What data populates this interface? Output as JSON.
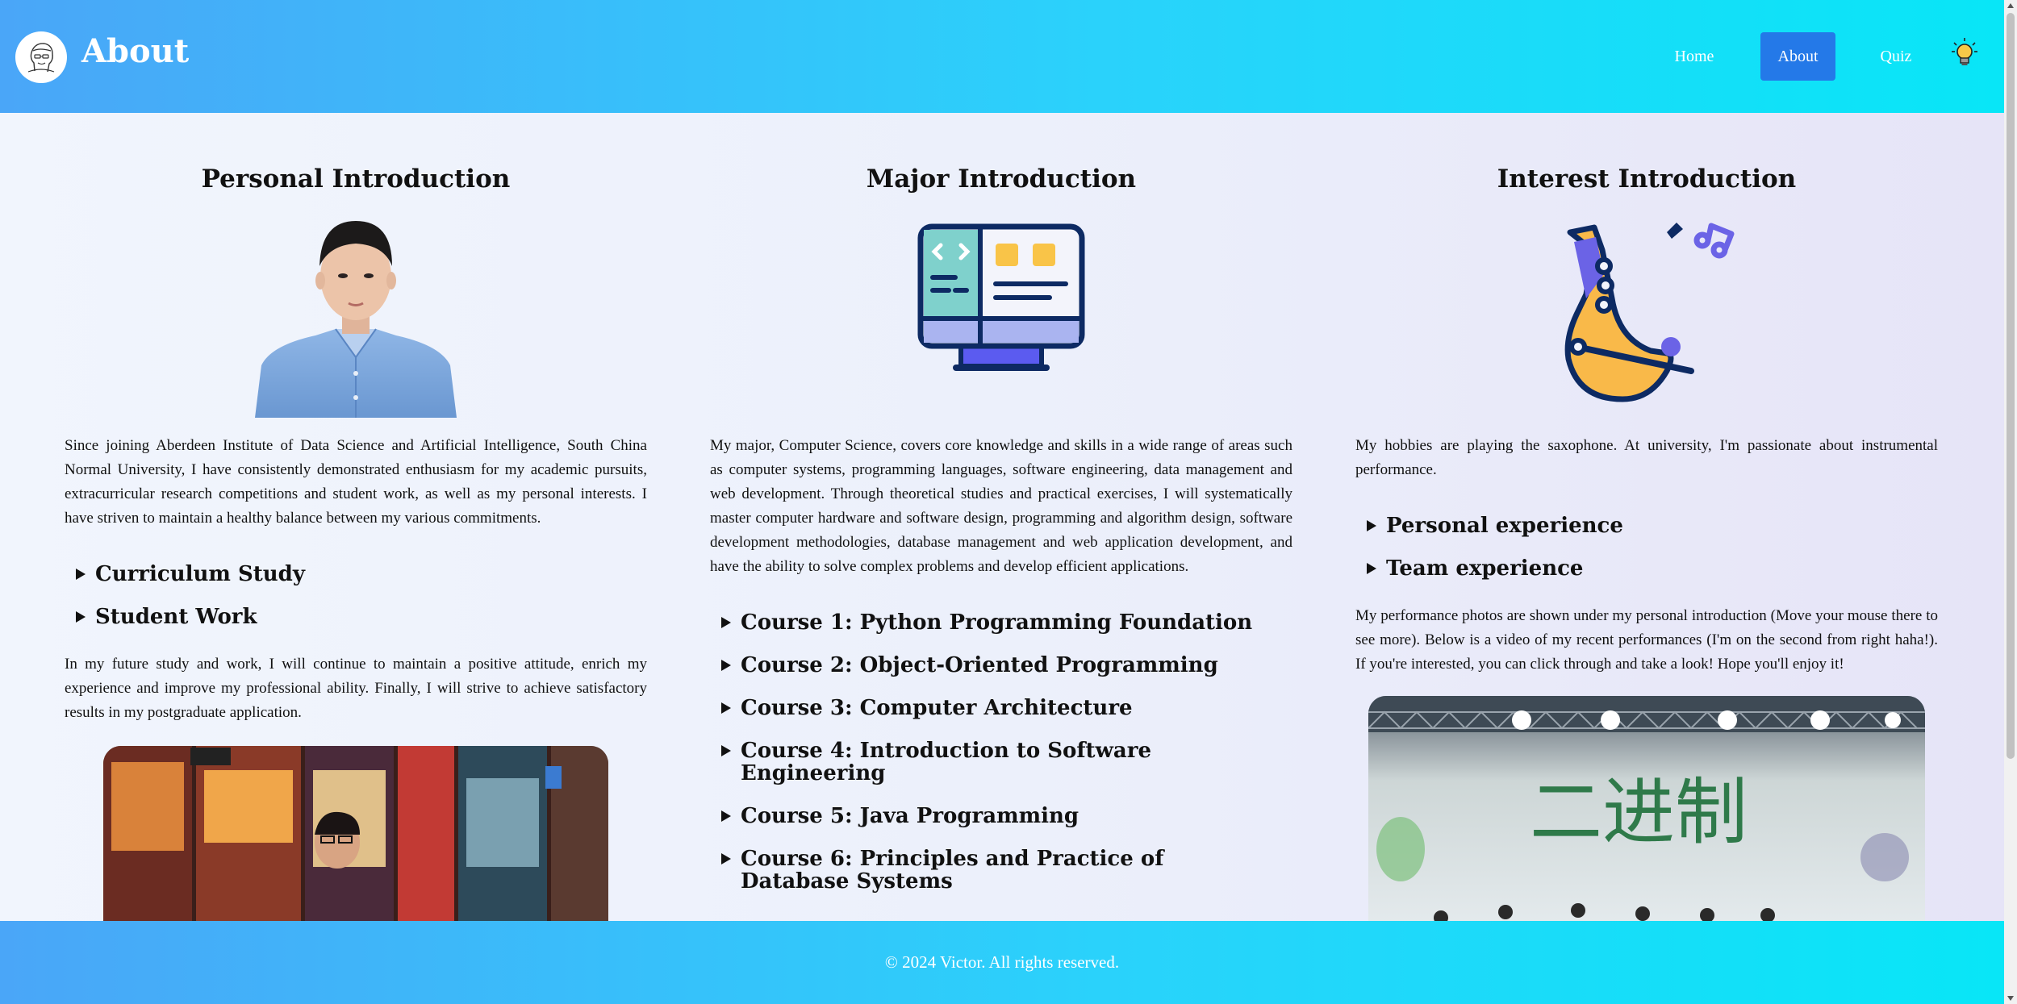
{
  "header": {
    "title": "About",
    "nav": {
      "home": "Home",
      "about": "About",
      "quiz": "Quiz"
    },
    "accent_color": "#2479e8"
  },
  "columns": {
    "personal": {
      "title": "Personal Introduction",
      "intro": "Since joining Aberdeen Institute of Data Science and Artificial Intelligence, South China Normal University, I have consistently demonstrated enthusiasm for my academic pursuits, extracurricular research competitions and student work, as well as my personal interests. I have striven to maintain a healthy balance between my various commitments.",
      "details": [
        "Curriculum Study",
        "Student Work"
      ],
      "outro": "In my future study and work, I will continue to maintain a positive attitude, enrich my experience and improve my professional ability. Finally, I will strive to achieve satisfactory results in my postgraduate application."
    },
    "major": {
      "title": "Major Introduction",
      "intro": "My major, Computer Science, covers core knowledge and skills in a wide range of areas such as computer systems, programming languages, software engineering, data management and web development. Through theoretical studies and practical exercises, I will systematically master computer hardware and software design, programming and algorithm design, software development methodologies, database management and web application development, and have the ability to solve complex problems and develop efficient applications.",
      "courses": [
        "Course 1: Python Programming Foundation",
        "Course 2: Object-Oriented Programming",
        "Course 3: Computer Architecture",
        "Course 4: Introduction to Software Engineering",
        "Course 5: Java Programming",
        "Course 6: Principles and Practice of Database Systems"
      ]
    },
    "interest": {
      "title": "Interest Introduction",
      "intro": "My hobbies are playing the saxophone. At university, I'm passionate about instrumental performance.",
      "details": [
        "Personal experience",
        "Team experience"
      ],
      "outro": "My performance photos are shown under my personal introduction (Move your mouse there to see more). Below is a video of my recent performances (I'm on the second from right haha!). If you're interested, you can click through and take a look! Hope you'll enjoy it!",
      "banner_text": "二进制"
    }
  },
  "footer": {
    "copyright": "© 2024 Victor. All rights reserved."
  }
}
